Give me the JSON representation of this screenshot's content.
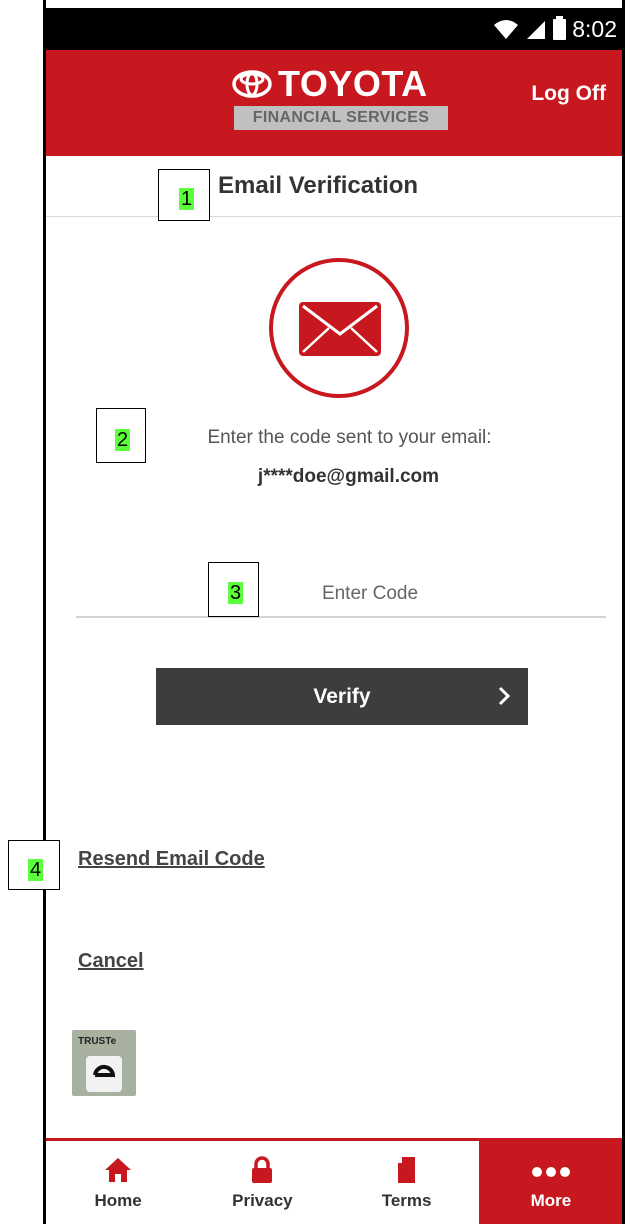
{
  "status_bar": {
    "time": "8:02"
  },
  "header": {
    "logo_word": "TOYOTA",
    "logo_sub": "FINANCIAL SERVICES",
    "logoff_label": "Log Off"
  },
  "page": {
    "title": "Email Verification",
    "instruction": "Enter the code sent to your email:",
    "email": "j****doe@gmail.com",
    "code_placeholder": "Enter Code",
    "code_value": "",
    "verify_label": "Verify",
    "resend_label": "Resend Email Code",
    "cancel_label": "Cancel",
    "truste_label": "TRUSTe"
  },
  "nav": {
    "items": [
      {
        "label": "Home",
        "icon": "home-icon",
        "active": false
      },
      {
        "label": "Privacy",
        "icon": "lock-icon",
        "active": false
      },
      {
        "label": "Terms",
        "icon": "document-icon",
        "active": false
      },
      {
        "label": "More",
        "icon": "more-dots-icon",
        "active": true
      }
    ]
  },
  "annotations": [
    "1",
    "2",
    "3",
    "4"
  ],
  "colors": {
    "brand_red": "#c8181f",
    "button_dark": "#3d3d3d",
    "marker_green": "#5cff3c"
  }
}
